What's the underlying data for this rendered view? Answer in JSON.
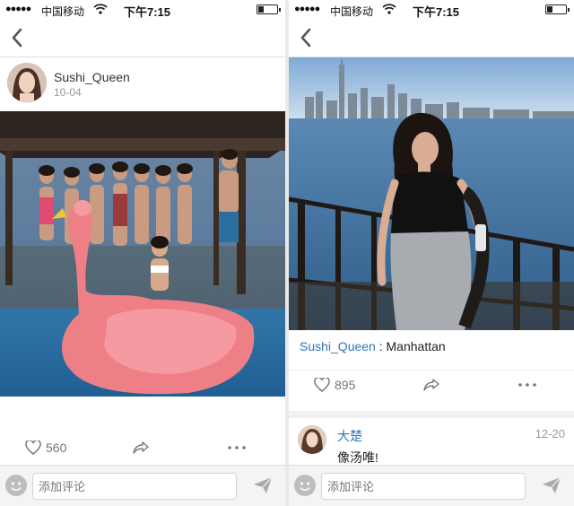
{
  "status_bar": {
    "carrier": "中国移动",
    "time": "下午7:15",
    "battery_level": 0.25
  },
  "left": {
    "post": {
      "author": "Sushi_Queen",
      "date": "10-04"
    },
    "actions": {
      "likes": "560"
    },
    "comment_input": {
      "placeholder": "添加评论"
    }
  },
  "right": {
    "post": {
      "author": "Sushi_Queen",
      "separator": " : ",
      "location": "Manhattan"
    },
    "actions": {
      "likes": "895"
    },
    "comment": {
      "name": "大楚",
      "text": "像汤唯!",
      "date": "12-20"
    },
    "comment_input": {
      "placeholder": "添加评论"
    }
  },
  "icons": [
    "back-icon",
    "heart-icon",
    "share-icon",
    "more-icon",
    "emoji-icon",
    "send-icon",
    "wifi-icon",
    "battery-icon"
  ],
  "colors": {
    "link_blue": "#2f76b5",
    "muted": "#999999",
    "divider": "#dddddd"
  }
}
